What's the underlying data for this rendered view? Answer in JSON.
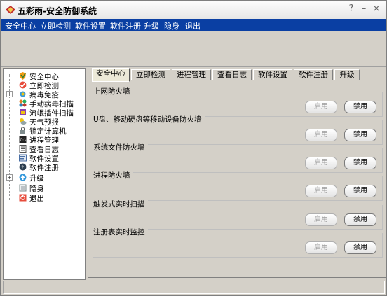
{
  "window": {
    "title": "五彩雨-安全防御系统",
    "controls": [
      "?",
      "–",
      "×"
    ]
  },
  "menu": [
    "安全中心",
    "立即检测",
    "软件设置",
    "软件注册",
    "升级",
    "隐身",
    "退出"
  ],
  "tree": [
    {
      "label": "安全中心",
      "icon": "shield-icon",
      "expander": ""
    },
    {
      "label": "立即检测",
      "icon": "check-icon",
      "expander": ""
    },
    {
      "label": "病毒免疫",
      "icon": "virus-icon",
      "expander": "+"
    },
    {
      "label": "手动病毒扫描",
      "icon": "scan-icon",
      "expander": ""
    },
    {
      "label": "流氓插件扫描",
      "icon": "plugin-icon",
      "expander": ""
    },
    {
      "label": "天气预报",
      "icon": "weather-icon",
      "expander": ""
    },
    {
      "label": "锁定计算机",
      "icon": "lock-icon",
      "expander": ""
    },
    {
      "label": "进程管理",
      "icon": "process-icon",
      "expander": ""
    },
    {
      "label": "查看日志",
      "icon": "log-icon",
      "expander": ""
    },
    {
      "label": "软件设置",
      "icon": "settings-icon",
      "expander": ""
    },
    {
      "label": "软件注册",
      "icon": "register-icon",
      "expander": ""
    },
    {
      "label": "升级",
      "icon": "upgrade-icon",
      "expander": "+"
    },
    {
      "label": "隐身",
      "icon": "stealth-icon",
      "expander": ""
    },
    {
      "label": "退出",
      "icon": "exit-icon",
      "expander": ""
    }
  ],
  "tabs": [
    "安全中心",
    "立即检测",
    "进程管理",
    "查看日志",
    "软件设置",
    "软件注册",
    "升级"
  ],
  "active_tab": 0,
  "sections": [
    {
      "title": "上网防火墙",
      "enable_label": "启用",
      "disable_label": "禁用"
    },
    {
      "title": "U盘、移动硬盘等移动设备防火墙",
      "enable_label": "启用",
      "disable_label": "禁用"
    },
    {
      "title": "系统文件防火墙",
      "enable_label": "启用",
      "disable_label": "禁用"
    },
    {
      "title": "进程防火墙",
      "enable_label": "启用",
      "disable_label": "禁用"
    },
    {
      "title": "触发式实时扫描",
      "enable_label": "启用",
      "disable_label": "禁用"
    },
    {
      "title": "注册表实时监控",
      "enable_label": "启用",
      "disable_label": "禁用"
    }
  ],
  "colors": {
    "menubar": "#0a3fa3",
    "window_bg": "#d4d0c8"
  }
}
